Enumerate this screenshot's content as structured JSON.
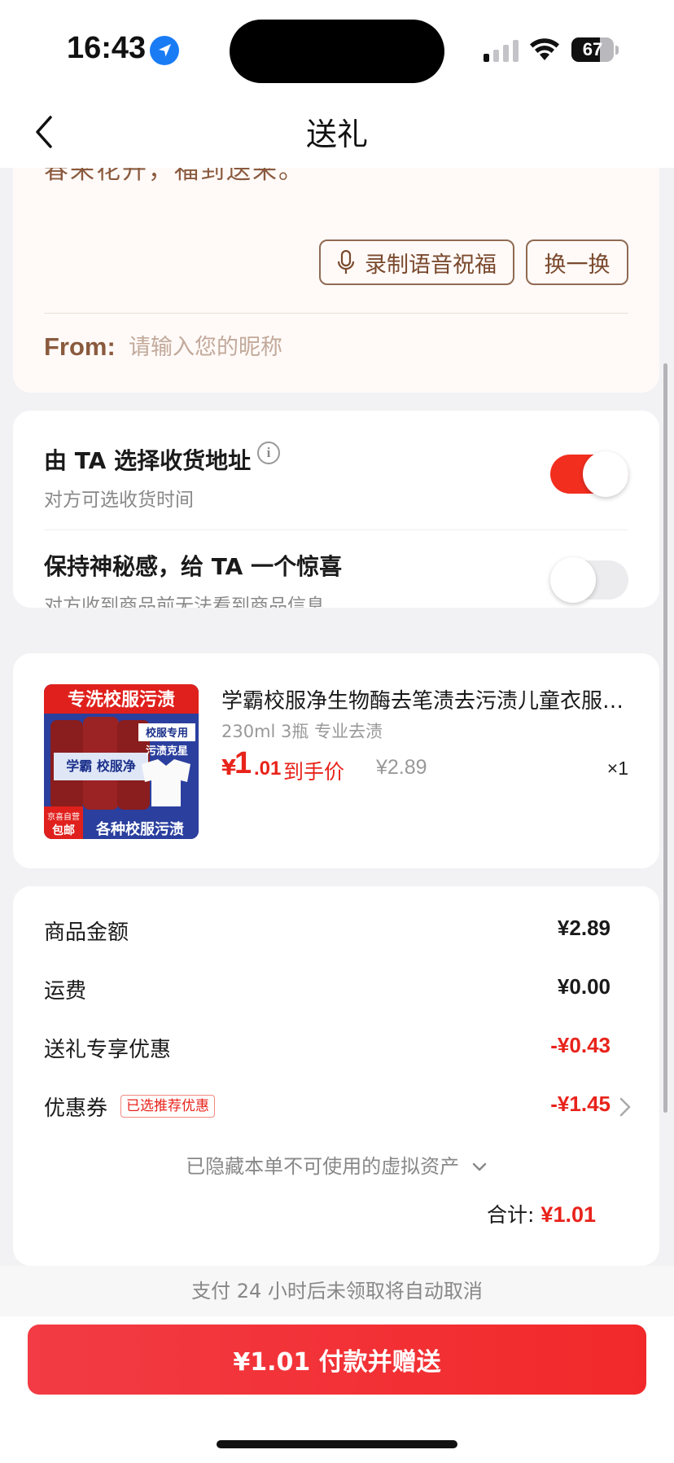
{
  "status_bar": {
    "time": "16:43",
    "battery": "67",
    "battery_level": 0.67,
    "icons": [
      "location-arrow-icon",
      "cellular-signal-icon",
      "wifi-icon",
      "battery-icon"
    ]
  },
  "nav": {
    "title": "送礼",
    "back_icon": "chevron-left-icon"
  },
  "message": {
    "text_cut": "春来花开，福到送来。",
    "voice_button": "录制语音祝福",
    "swap_button": "换一换",
    "from_label": "From:",
    "from_placeholder": "请输入您的昵称",
    "from_value": ""
  },
  "options": {
    "choose_address": {
      "title": "由 TA 选择收货地址",
      "subtitle": "对方可选收货时间",
      "enabled": true
    },
    "mystery": {
      "title": "保持神秘感，给 TA 一个惊喜",
      "subtitle": "对方收到商品前无法看到商品信息",
      "enabled": false
    },
    "accent_color": "#f22e1f"
  },
  "product": {
    "name": "学霸校服净生物酶去笔渍去污渍儿童衣服专用洗衣液",
    "spec": "230ml 3瓶 专业去渍",
    "price_symbol": "¥",
    "price_int": "1",
    "price_dec": ".01",
    "price_tag": "到手价",
    "original_price": "¥2.89",
    "quantity": "×1",
    "image_text": {
      "banner": "专洗校服污渍",
      "bottle_label": "学霸 校服净",
      "side_tag": "校服专用",
      "side_tag2": "污渍克星",
      "corner_badge": "京喜自营",
      "free_ship": "包邮",
      "bottom_text": "各种校服污渍"
    }
  },
  "summary": {
    "rows": [
      {
        "label": "商品金额",
        "value": "¥2.89",
        "red": false
      },
      {
        "label": "运费",
        "value": "¥0.00",
        "red": false
      },
      {
        "label": "送礼专享优惠",
        "value": "-¥0.43",
        "red": true
      },
      {
        "label": "优惠券",
        "value": "-¥1.45",
        "red": true
      }
    ],
    "coupon_badge": "已选推荐优惠",
    "hidden_assets": "已隐藏本单不可使用的虚拟资产",
    "total_label": "合计:",
    "total_value": "¥1.01"
  },
  "bottom": {
    "notice": "支付 24 小时后未领取将自动取消",
    "pay_button": "¥1.01 付款并赠送",
    "brand_color": "#e8231b"
  }
}
